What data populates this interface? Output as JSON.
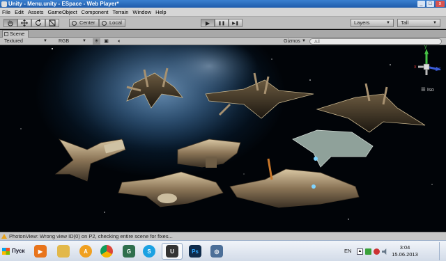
{
  "window": {
    "title": "Unity - Menu.unity - ESpace - Web Player*",
    "minimize": "_",
    "maximize": "□",
    "close": "x"
  },
  "menu": [
    "File",
    "Edit",
    "Assets",
    "GameObject",
    "Component",
    "Terrain",
    "Window",
    "Help"
  ],
  "toolbar": {
    "tools": [
      "hand-icon",
      "move-icon",
      "rotate-icon",
      "scale-icon"
    ],
    "pivot_center": "Center",
    "pivot_local": "Local",
    "play": "▶",
    "pause": "❚❚",
    "step": "▶❚",
    "layers": "Layers",
    "layout": "Tall"
  },
  "scene": {
    "tab_label": "Scene",
    "render_mode": "Textured",
    "color_mode": "RGB",
    "gizmos": "Gizmos",
    "search_placeholder": "All",
    "projection": "Iso",
    "axis_x": "x",
    "axis_y": "y",
    "axis_z": "z"
  },
  "status": {
    "message": "PhotonView: Wrong view ID(0) on P2, checking entire scene for fixes..."
  },
  "taskbar": {
    "start_label": "Пуск",
    "apps": [
      {
        "name": "media-player",
        "glyph": "▶",
        "color": "#e8741c"
      },
      {
        "name": "file-explorer",
        "glyph": "",
        "color": "#e2b84a"
      },
      {
        "name": "aimp",
        "glyph": "A",
        "color": "#f0a020"
      },
      {
        "name": "chrome",
        "glyph": "",
        "color": "#3b8a3e"
      },
      {
        "name": "app-green",
        "glyph": "G",
        "color": "#2f6f4d"
      },
      {
        "name": "skype",
        "glyph": "S",
        "color": "#1ba1e2"
      },
      {
        "name": "unity",
        "glyph": "U",
        "color": "#333333",
        "active": true
      },
      {
        "name": "photoshop",
        "glyph": "Ps",
        "color": "#0f2b4a"
      },
      {
        "name": "app-blue",
        "glyph": "◎",
        "color": "#4c6f98"
      }
    ],
    "language": "EN",
    "time": "3:04",
    "date": "15.06.2013"
  }
}
